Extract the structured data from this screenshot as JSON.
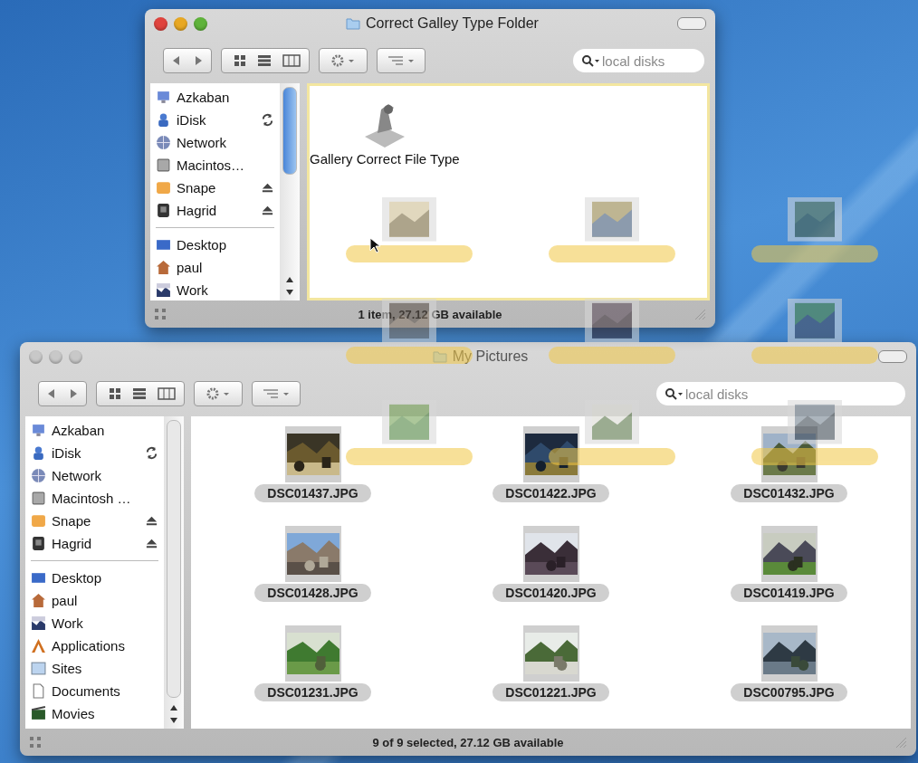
{
  "windows": [
    {
      "title": "Correct Galley Type Folder",
      "active": true,
      "search": {
        "placeholder": "local disks"
      },
      "sidebar": {
        "devices": [
          {
            "name": "Azkaban",
            "kind": "computer"
          },
          {
            "name": "iDisk",
            "kind": "idisk",
            "syncing": true
          },
          {
            "name": "Network",
            "kind": "network"
          },
          {
            "name": "Macintos…",
            "kind": "harddisk"
          },
          {
            "name": "Snape",
            "kind": "volume",
            "ejectable": true
          },
          {
            "name": "Hagrid",
            "kind": "darkvolume",
            "ejectable": true
          }
        ],
        "places": [
          {
            "name": "Desktop",
            "kind": "desktop"
          },
          {
            "name": "paul",
            "kind": "home"
          },
          {
            "name": "Work",
            "kind": "work"
          }
        ]
      },
      "drop_highlight": true,
      "items": [
        {
          "kind": "app",
          "name": "Gallery Correct File Type"
        }
      ],
      "status": "1 item, 27.12 GB available"
    },
    {
      "title": "My Pictures",
      "active": false,
      "search": {
        "placeholder": "local disks"
      },
      "sidebar": {
        "devices": [
          {
            "name": "Azkaban",
            "kind": "computer"
          },
          {
            "name": "iDisk",
            "kind": "idisk",
            "syncing": true
          },
          {
            "name": "Network",
            "kind": "network"
          },
          {
            "name": "Macintosh …",
            "kind": "harddisk"
          },
          {
            "name": "Snape",
            "kind": "volume",
            "ejectable": true
          },
          {
            "name": "Hagrid",
            "kind": "darkvolume",
            "ejectable": true
          }
        ],
        "places": [
          {
            "name": "Desktop",
            "kind": "desktop"
          },
          {
            "name": "paul",
            "kind": "home"
          },
          {
            "name": "Work",
            "kind": "work"
          },
          {
            "name": "Applications",
            "kind": "apps"
          },
          {
            "name": "Sites",
            "kind": "sites"
          },
          {
            "name": "Documents",
            "kind": "docs"
          },
          {
            "name": "Movies",
            "kind": "movies"
          }
        ]
      },
      "drop_highlight": false,
      "items": [
        {
          "name": "DSC01437.JPG",
          "selected": true
        },
        {
          "name": "DSC01422.JPG",
          "selected": true
        },
        {
          "name": "DSC01432.JPG",
          "selected": true
        },
        {
          "name": "DSC01428.JPG",
          "selected": true
        },
        {
          "name": "DSC01420.JPG",
          "selected": true
        },
        {
          "name": "DSC01419.JPG",
          "selected": true
        },
        {
          "name": "DSC01231.JPG",
          "selected": true
        },
        {
          "name": "DSC01221.JPG",
          "selected": true
        },
        {
          "name": "DSC00795.JPG",
          "selected": true
        }
      ],
      "status": "9 of 9 selected, 27.12 GB available"
    }
  ]
}
